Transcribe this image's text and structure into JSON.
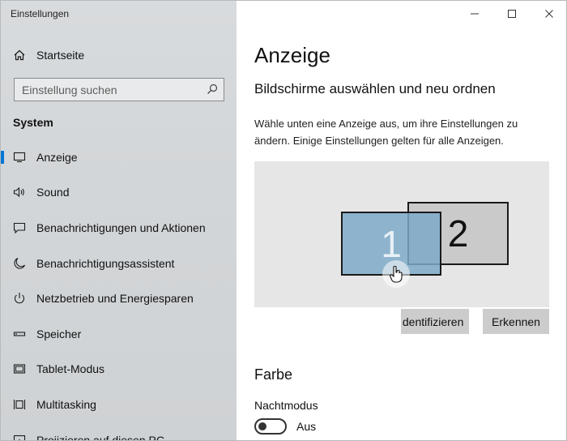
{
  "window": {
    "title": "Einstellungen"
  },
  "sidebar": {
    "home_label": "Startseite",
    "search": {
      "placeholder": "Einstellung suchen",
      "value": ""
    },
    "section": "System",
    "items": [
      {
        "label": "Anzeige",
        "icon": "monitor-icon",
        "active": true
      },
      {
        "label": "Sound",
        "icon": "speaker-icon",
        "active": false
      },
      {
        "label": "Benachrichtigungen und Aktionen",
        "icon": "message-icon",
        "active": false
      },
      {
        "label": "Benachrichtigungsassistent",
        "icon": "moon-icon",
        "active": false
      },
      {
        "label": "Netzbetrieb und Energiesparen",
        "icon": "power-icon",
        "active": false
      },
      {
        "label": "Speicher",
        "icon": "storage-icon",
        "active": false
      },
      {
        "label": "Tablet-Modus",
        "icon": "tablet-icon",
        "active": false
      },
      {
        "label": "Multitasking",
        "icon": "multitasking-icon",
        "active": false
      },
      {
        "label": "Projizieren auf diesen PC",
        "icon": "project-icon",
        "active": false
      }
    ]
  },
  "main": {
    "title": "Anzeige",
    "subtitle": "Bildschirme auswählen und neu ordnen",
    "description": "Wähle unten eine Anzeige aus, um ihre Einstellungen zu ändern. Einige Einstellungen gelten für alle Anzeigen.",
    "monitors": {
      "first": "1",
      "second": "2"
    },
    "identify_label": "Identifizieren",
    "detect_label": "Erkennen",
    "color_section": "Farbe",
    "night_mode_label": "Nachtmodus",
    "night_mode_state": "Aus"
  },
  "colors": {
    "accent": "#0078d7",
    "sidebar_bg": "#d3d6d8",
    "button_bg": "#cccccc",
    "monitor_selected": "#7eaac8"
  }
}
